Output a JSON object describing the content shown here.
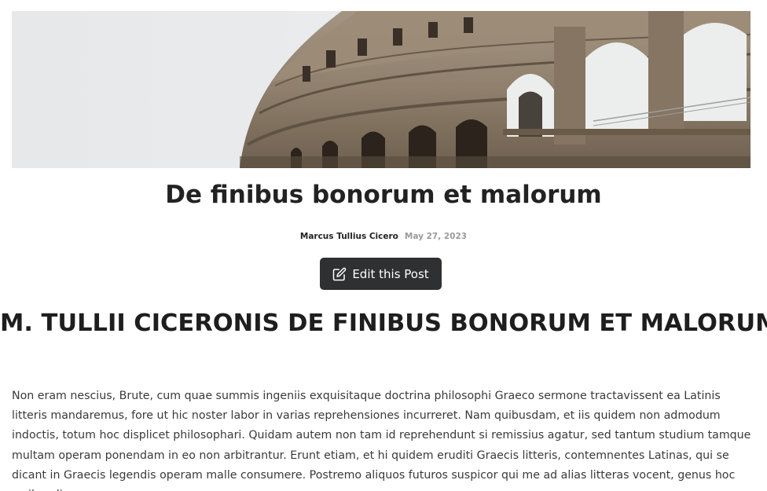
{
  "hero": {
    "image_subject": "Colosseum exterior arches against pale sky"
  },
  "post": {
    "title": "De finibus bonorum et malorum",
    "author": "Marcus Tullius Cicero",
    "date": "May 27, 2023",
    "edit_label": "Edit this Post",
    "edit_icon": "pencil-square-icon",
    "section_heading": "M. TULLII CICERONIS DE FINIBUS BONORUM ET MALORUM",
    "body": "Non eram nescius, Brute, cum quae summis ingeniis exquisitaque doctrina philosophi Graeco sermone tractavissent ea Latinis litteris mandaremus, fore ut hic noster labor in varias reprehensiones incurreret. Nam quibusdam, et iis quidem non admodum indoctis, totum hoc displicet philosophari. Quidam autem non tam id reprehendunt si remissius agatur, sed tantum studium tamque multam operam ponendam in eo non arbitrantur. Erunt etiam, et hi quidem eruditi Graecis litteris, contemnentes Latinas, qui se dicant in Graecis legendis operam malle consumere. Postremo aliquos futuros suspicor qui me ad alias litteras vocent, genus hoc scribendi,"
  },
  "colors": {
    "button_bg": "#2f3032",
    "date_text": "#9a9a9a",
    "body_text": "#3a3a3a"
  }
}
